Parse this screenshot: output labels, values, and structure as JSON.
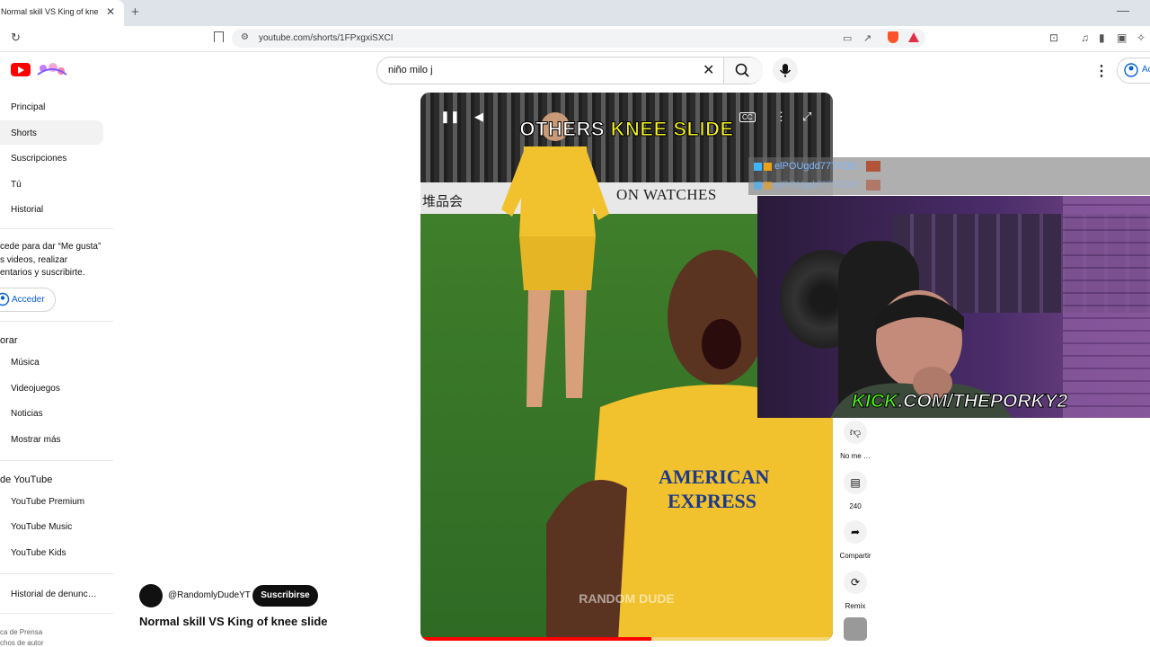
{
  "browser": {
    "tab_title": "Normal skill VS King of knee",
    "tab_close": "✕",
    "new_tab": "+",
    "url": "youtube.com/shorts/1FPxgxiSXCI"
  },
  "header": {
    "search_value": "niño milo j",
    "signin_label": "Ac"
  },
  "sidebar": {
    "items": [
      {
        "label": "Principal"
      },
      {
        "label": "Shorts"
      },
      {
        "label": "Suscripciones"
      },
      {
        "label": "Tú"
      },
      {
        "label": "Historial"
      }
    ],
    "signin_prompt": [
      "cede para dar “Me gusta”",
      "s videos, realizar",
      "entarios y suscribirte."
    ],
    "acceder": "Acceder",
    "explore_heading": "orar",
    "explore_items": [
      {
        "label": "Música"
      },
      {
        "label": "Videojuegos"
      },
      {
        "label": "Noticias"
      },
      {
        "label": "Mostrar más"
      }
    ],
    "more_heading": "de YouTube",
    "more_items": [
      {
        "label": "YouTube Premium"
      },
      {
        "label": "YouTube Music"
      },
      {
        "label": "YouTube Kids"
      }
    ],
    "report_history": "Historial de denunc…",
    "footer_line1": "ca de   Prensa",
    "footer_line2": "chos de autor"
  },
  "video": {
    "overlay_part1": "OTHERS ",
    "overlay_part2": "KNEE SLIDE",
    "banner_text": "ON WATCHES",
    "banner_kanji": "堆品会",
    "jersey_text": "AMERICAN EXPRESS",
    "watermark": "RANDOM DUDE",
    "cc_label": "CC",
    "progress": 0.56
  },
  "channel": {
    "handle": "@RandomlyDudeYT",
    "subscribe": "Suscribirse",
    "title": "Normal skill VS King of knee slide"
  },
  "actions": {
    "dislike_label": "No me …",
    "comments_count": "240",
    "share_label": "Compartir",
    "remix_label": "Remix"
  },
  "stream_overlay": {
    "chat": [
      {
        "user": "elPOUgdd777XDD :"
      },
      {
        "user": "elPOUgdd777XDD :"
      }
    ],
    "kick_prefix": "KICK",
    "kick_rest": ".COM/THEPORKY2"
  },
  "colors": {
    "yt_red": "#ff0000",
    "link_blue": "#065fd4",
    "kick_green": "#53fc18",
    "jersey_yellow": "#f2c12e"
  }
}
